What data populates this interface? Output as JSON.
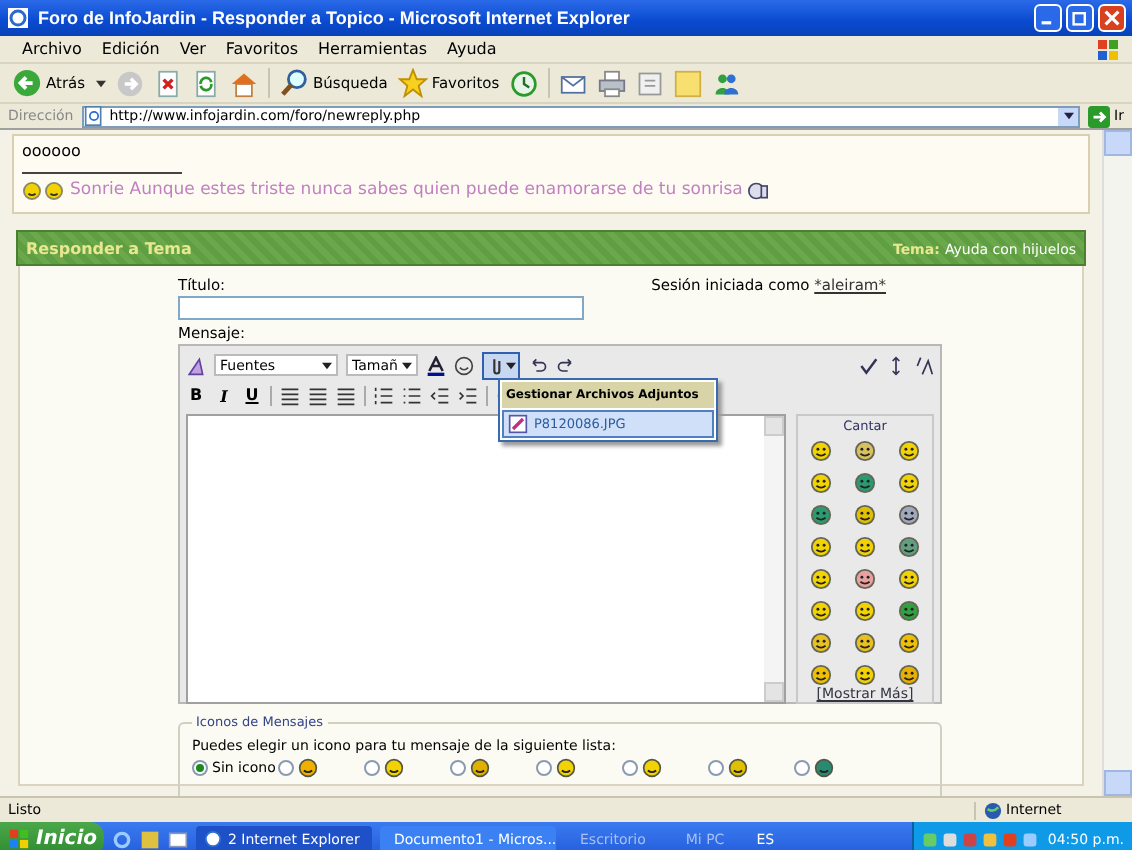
{
  "window": {
    "title": "Foro de InfoJardin - Responder a Topico - Microsoft Internet Explorer"
  },
  "menu": [
    "Archivo",
    "Edición",
    "Ver",
    "Favoritos",
    "Herramientas",
    "Ayuda"
  ],
  "toolbar": {
    "back": "Atrás",
    "search": "Búsqueda",
    "favorites": "Favoritos"
  },
  "address": {
    "label": "Dirección",
    "url": "http://www.infojardin.com/foro/newreply.php",
    "go": "Ir"
  },
  "signature": {
    "line1": "oooooo",
    "text": "Sonrie Aunque estes triste nunca sabes quien puede enamorarse de tu sonrisa"
  },
  "header": {
    "title": "Responder a Tema",
    "topic_label": "Tema:",
    "topic": "Ayuda con hijuelos"
  },
  "form": {
    "title_label": "Título:",
    "session_text": "Sesión iniciada como",
    "user": "*aleiram*",
    "message_label": "Mensaje:"
  },
  "editor": {
    "font": "Fuentes",
    "size": "Tamañ",
    "format_buttons": [
      "B",
      "I",
      "U"
    ],
    "attach_menu": {
      "title": "Gestionar Archivos Adjuntos",
      "files": [
        "P8120086.JPG"
      ]
    },
    "smilies_title": "Cantar",
    "more": "[Mostrar Más]"
  },
  "message_icons": {
    "legend": "Iconos de Mensajes",
    "prompt": "Puedes elegir un icono para tu mensaje de la siguiente lista:",
    "options": [
      {
        "label": "Sin icono",
        "selected": true
      },
      {
        "selected": false
      },
      {
        "selected": false
      },
      {
        "selected": false
      },
      {
        "selected": false
      },
      {
        "selected": false
      },
      {
        "selected": false
      },
      {
        "selected": false
      }
    ]
  },
  "status_bar": {
    "text": "Listo",
    "zone": "Internet"
  },
  "taskbar": {
    "start": "Inicio",
    "tasks": [
      {
        "label": "2 Internet Explorer",
        "selected": true
      },
      {
        "label": "Documento1 - Micros...",
        "selected": false
      }
    ],
    "toolbars": [
      "Escritorio",
      "Mi PC"
    ],
    "language": "ES",
    "clock": "04:50 p.m."
  }
}
